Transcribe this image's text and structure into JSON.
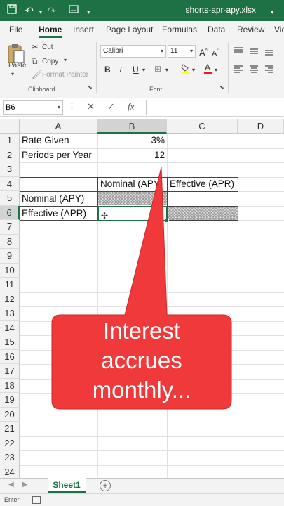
{
  "window": {
    "filename": "shorts-apr-apy.xlsx"
  },
  "ribbon_tabs": [
    "File",
    "Home",
    "Insert",
    "Page Layout",
    "Formulas",
    "Data",
    "Review",
    "Viev"
  ],
  "clipboard": {
    "paste": "Paste",
    "cut": "Cut",
    "copy": "Copy",
    "format_painter": "Format Painter",
    "group_label": "Clipboard"
  },
  "font": {
    "name": "Calibri",
    "size": "11",
    "group_label": "Font",
    "bold": "B",
    "italic": "I",
    "underline": "U"
  },
  "formula_bar": {
    "name_box": "B6",
    "value": ""
  },
  "columns": [
    "A",
    "B",
    "C",
    "D"
  ],
  "rows": [
    "1",
    "2",
    "3",
    "4",
    "5",
    "6",
    "7",
    "8",
    "9",
    "10",
    "11",
    "12",
    "13",
    "14",
    "15",
    "16",
    "17",
    "18",
    "19",
    "20",
    "21",
    "22",
    "23",
    "24"
  ],
  "cells": {
    "A1": "Rate Given",
    "B1": "3%",
    "A2": "Periods per Year",
    "B2": "12",
    "B4": "Nominal (APY)",
    "C4": "Effective (APR)",
    "A5": "Nominal (APY)",
    "A6": "Effective (APR)"
  },
  "callout": {
    "line1": "Interest",
    "line2": "accrues",
    "line3": "monthly...",
    "color": "#f0393b"
  },
  "sheets": [
    {
      "name": "Sheet1",
      "active": true
    }
  ],
  "status": {
    "mode": "Enter"
  },
  "colors": {
    "accent": "#1e7145",
    "callout": "#f0393b"
  }
}
